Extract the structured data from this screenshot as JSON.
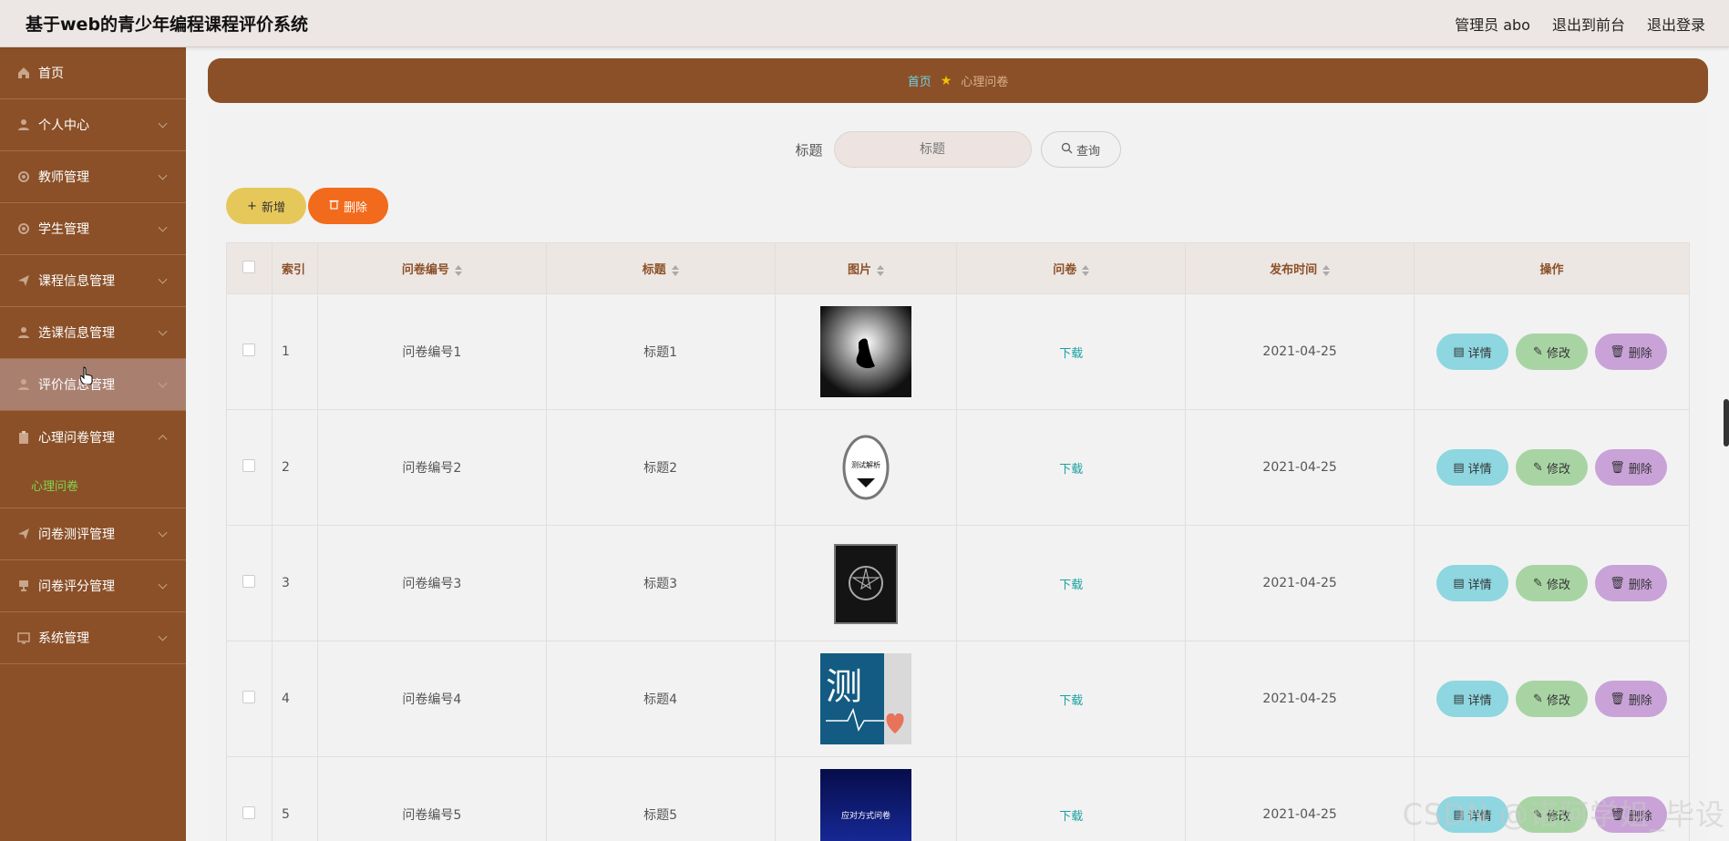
{
  "header": {
    "title": "基于web的青少年编程课程评价系统",
    "user": "管理员 abo",
    "front_link": "退出到前台",
    "logout_link": "退出登录"
  },
  "sidebar": {
    "items": [
      {
        "label": "首页",
        "icon": "home-icon"
      },
      {
        "label": "个人中心",
        "icon": "user-icon"
      },
      {
        "label": "教师管理",
        "icon": "gear-icon"
      },
      {
        "label": "学生管理",
        "icon": "gear-icon"
      },
      {
        "label": "课程信息管理",
        "icon": "send-icon"
      },
      {
        "label": "选课信息管理",
        "icon": "user-icon"
      },
      {
        "label": "评价信息管理",
        "icon": "user-icon"
      },
      {
        "label": "心理问卷管理",
        "icon": "clipboard-icon"
      },
      {
        "label": "问卷测评管理",
        "icon": "send-icon"
      },
      {
        "label": "问卷评分管理",
        "icon": "trophy-icon"
      },
      {
        "label": "系统管理",
        "icon": "monitor-icon"
      }
    ],
    "sub_item": "心理问卷"
  },
  "breadcrumb": {
    "home": "首页",
    "current": "心理问卷"
  },
  "search": {
    "label": "标题",
    "placeholder": "标题",
    "button": "查询"
  },
  "actions": {
    "add": "新增",
    "delete": "删除"
  },
  "table": {
    "headers": {
      "index": "索引",
      "code": "问卷编号",
      "title": "标题",
      "image": "图片",
      "survey": "问卷",
      "time": "发布时间",
      "ops": "操作"
    },
    "rows": [
      {
        "index": "1",
        "code": "问卷编号1",
        "title": "标题1",
        "survey": "下载",
        "time": "2021-04-25",
        "image_text": ""
      },
      {
        "index": "2",
        "code": "问卷编号2",
        "title": "标题2",
        "survey": "下载",
        "time": "2021-04-25",
        "image_text": "测试解析"
      },
      {
        "index": "3",
        "code": "问卷编号3",
        "title": "标题3",
        "survey": "下载",
        "time": "2021-04-25",
        "image_text": ""
      },
      {
        "index": "4",
        "code": "问卷编号4",
        "title": "标题4",
        "survey": "下载",
        "time": "2021-04-25",
        "image_text": "测"
      },
      {
        "index": "5",
        "code": "问卷编号5",
        "title": "标题5",
        "survey": "下载",
        "time": "2021-04-25",
        "image_text": "应对方式问卷"
      }
    ],
    "op_labels": {
      "detail": "详情",
      "edit": "修改",
      "delete": "删除"
    }
  },
  "watermark": "CSDN @诺阿学姐_毕设",
  "colors": {
    "sidebar": "#8b5028",
    "accent_green": "#7fd64f",
    "download": "#1aa1a0"
  }
}
